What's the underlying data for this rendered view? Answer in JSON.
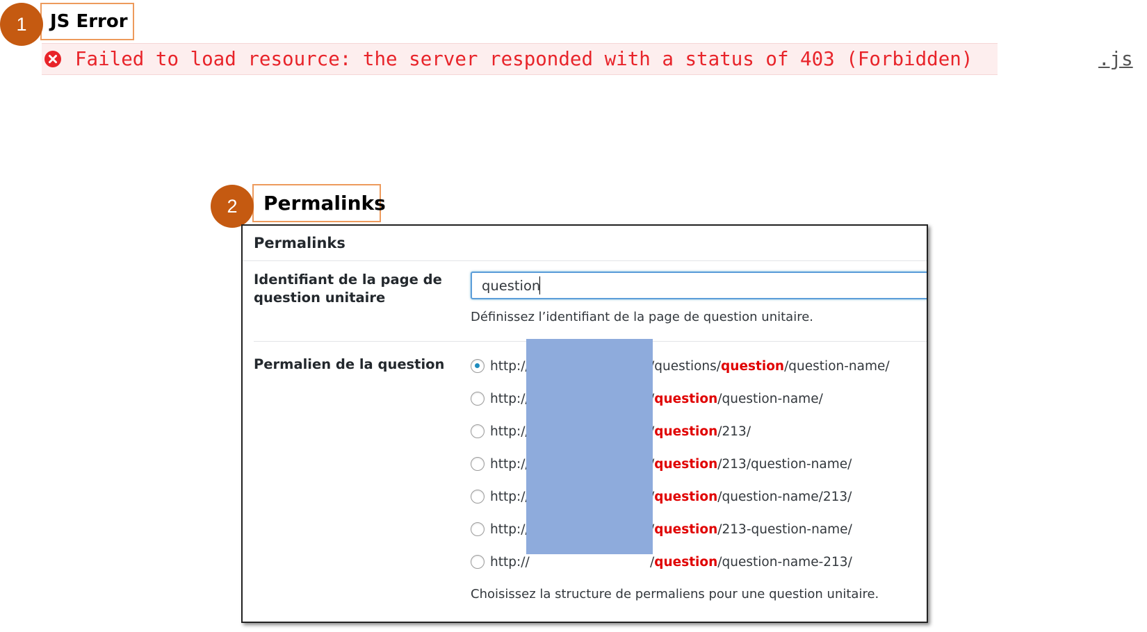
{
  "callout_1": {
    "number": "1",
    "label": "JS Error"
  },
  "console": {
    "message": "Failed to load resource: the server responded with a status of 403 (Forbidden)",
    "source": ".js",
    "colors": {
      "error_text": "#e8242a",
      "row_background": "#fdeeee"
    }
  },
  "callout_2": {
    "number": "2",
    "label": "Permalinks"
  },
  "panel": {
    "title": "Permalinks",
    "slug_field": {
      "label_line1": "Identifiant de la page de",
      "label_line2": "question unitaire",
      "value": "question",
      "help": "Définissez l’identifiant de la page de question unitaire."
    },
    "permalink_field": {
      "label": "Permalien de la question",
      "options": [
        {
          "prefix": "http://",
          "before": "/questions/",
          "keyword": "question",
          "after": "/question-name/",
          "checked": true
        },
        {
          "prefix": "http://",
          "before": "/",
          "keyword": "question",
          "after": "/question-name/",
          "checked": false
        },
        {
          "prefix": "http://",
          "before": "/",
          "keyword": "question",
          "after": "/213/",
          "checked": false
        },
        {
          "prefix": "http://",
          "before": "/",
          "keyword": "question",
          "after": "/213/question-name/",
          "checked": false
        },
        {
          "prefix": "http://",
          "before": "/",
          "keyword": "question",
          "after": "/question-name/213/",
          "checked": false
        },
        {
          "prefix": "http://",
          "before": "/",
          "keyword": "question",
          "after": "/213-question-name/",
          "checked": false
        },
        {
          "prefix": "http://",
          "before": "/",
          "keyword": "question",
          "after": "/question-name-213/",
          "checked": false
        }
      ],
      "help": "Choisissez la structure de permaliens pour une question unitaire."
    }
  },
  "colors": {
    "callout_badge": "#c55a11",
    "callout_border": "#ed9a5c",
    "keyword_accent": "#e00000",
    "redaction_fill": "#8eabdc",
    "focus_blue": "#5b9dd9"
  },
  "icons": {
    "error": "error-circle-icon"
  }
}
